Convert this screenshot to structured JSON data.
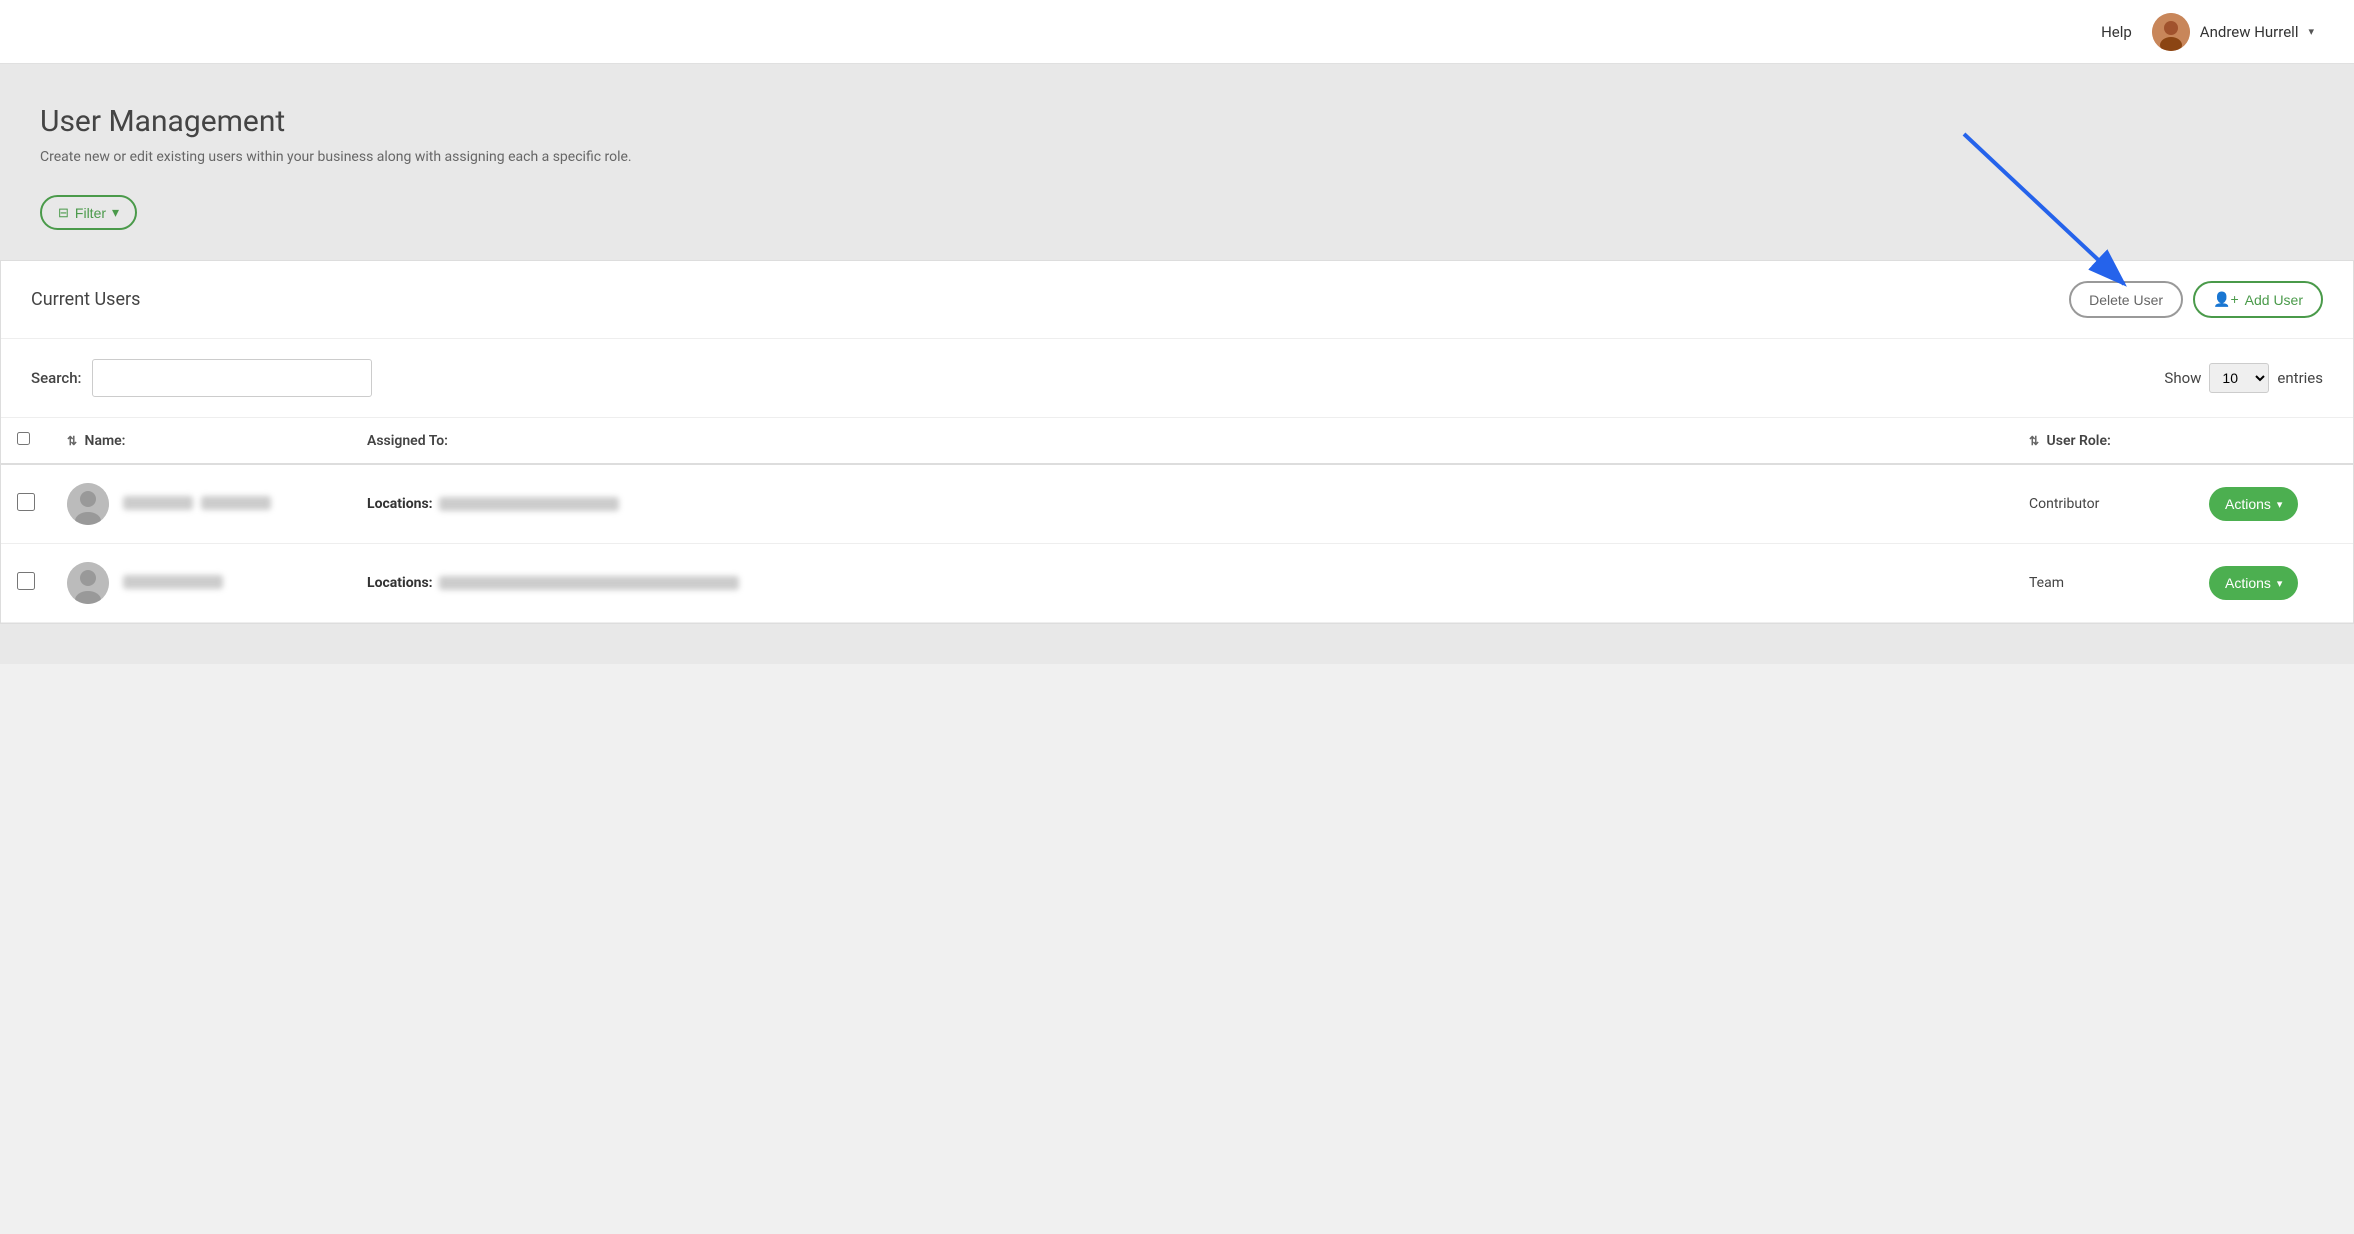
{
  "topNav": {
    "help_label": "Help",
    "user_name": "Andrew Hurrell",
    "chevron": "▾"
  },
  "pageHeader": {
    "title": "User Management",
    "subtitle": "Create new or edit existing users within your business along with assigning each a specific role.",
    "filter_label": "Filter",
    "filter_icon": "≡"
  },
  "card": {
    "title": "Current Users",
    "delete_label": "Delete User",
    "add_label": "Add User",
    "add_icon": "👤"
  },
  "search": {
    "label": "Search:",
    "placeholder": "",
    "show_label": "Show",
    "show_value": "10",
    "entries_label": "entries"
  },
  "table": {
    "columns": [
      {
        "key": "check",
        "label": ""
      },
      {
        "key": "name",
        "label": "Name:",
        "sortable": true
      },
      {
        "key": "assigned",
        "label": "Assigned To:",
        "sortable": false
      },
      {
        "key": "role",
        "label": "User Role:",
        "sortable": true
      },
      {
        "key": "actions",
        "label": ""
      }
    ],
    "rows": [
      {
        "id": 1,
        "name_blurred_w1": 70,
        "name_blurred_w2": 70,
        "assigned_label": "Locations:",
        "assigned_blurred_w": 180,
        "role": "Contributor",
        "actions_label": "Actions"
      },
      {
        "id": 2,
        "name_blurred_w1": 100,
        "name_blurred_w2": 0,
        "assigned_label": "Locations:",
        "assigned_blurred_w": 300,
        "role": "Team",
        "actions_label": "Actions"
      }
    ]
  }
}
